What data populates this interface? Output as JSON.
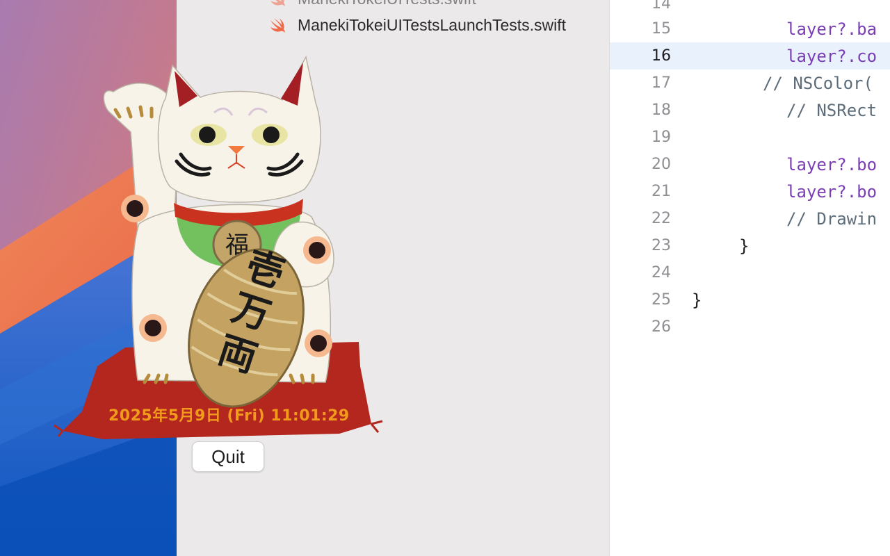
{
  "navigator": {
    "items": [
      {
        "label": "ManekiTokeiUITests.swift",
        "icon": "swift-file-icon"
      },
      {
        "label": "ManekiTokeiUITestsLaunchTests.swift",
        "icon": "swift-file-icon"
      }
    ]
  },
  "editor": {
    "lines": [
      {
        "number": "14",
        "code": ""
      },
      {
        "number": "15",
        "code": "layer?.ba"
      },
      {
        "number": "16",
        "code": "layer?.co"
      },
      {
        "number": "17",
        "code": "// NSColor("
      },
      {
        "number": "18",
        "code": "// NSRect"
      },
      {
        "number": "19",
        "code": ""
      },
      {
        "number": "20",
        "code": "layer?.bo"
      },
      {
        "number": "21",
        "code": "layer?.bo"
      },
      {
        "number": "22",
        "code": "// Drawin"
      },
      {
        "number": "23",
        "code": "}"
      },
      {
        "number": "24",
        "code": ""
      },
      {
        "number": "25",
        "code": "}"
      },
      {
        "number": "26",
        "code": ""
      }
    ],
    "current_line": "16"
  },
  "widget": {
    "coin_chars": "福",
    "koban_text": "壱万両",
    "clock_text": "2025年5月9日 (Fri) 11:01:29",
    "quit_label": "Quit"
  },
  "colors": {
    "code_keyword": "#7a3fb4",
    "code_comment": "#5d6c79",
    "clock_text": "#f19a1c",
    "cushion": "#b3271f",
    "collar": "#c8321e",
    "bib": "#72c15e"
  }
}
